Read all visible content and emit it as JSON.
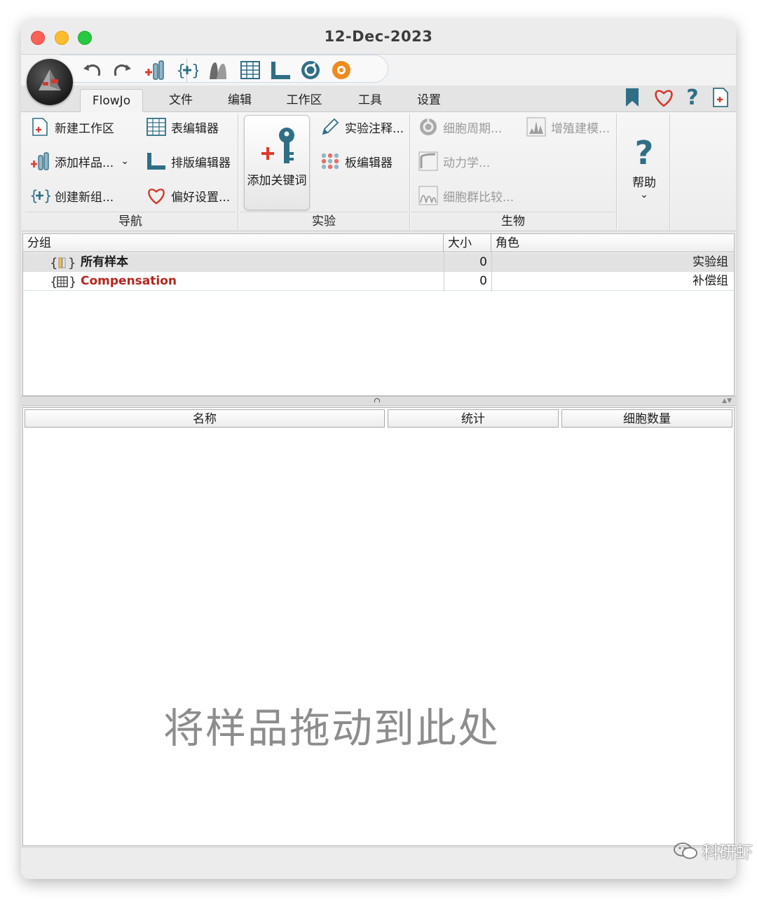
{
  "window": {
    "title": "12-Dec-2023"
  },
  "quick_toolbar": {
    "icons": [
      "undo-icon",
      "redo-icon",
      "add-samples-icon",
      "create-group-icon",
      "layer-icon",
      "table-icon",
      "layout-icon",
      "refresh-icon",
      "bio-icon"
    ]
  },
  "tabs": [
    "FlowJo",
    "文件",
    "编辑",
    "工作区",
    "工具",
    "设置"
  ],
  "ribbon": {
    "nav": {
      "new_workspace": "新建工作区",
      "add_samples": "添加样品...",
      "create_group": "创建新组...",
      "label": "导航"
    },
    "editors": {
      "table_editor": "表编辑器",
      "layout_editor": "排版编辑器",
      "preferences": "偏好设置..."
    },
    "experiment": {
      "add_keyword": "添加关键词",
      "annotate": "实验注释...",
      "plate_editor": "板编辑器",
      "label": "实验"
    },
    "biology": {
      "cell_cycle": "细胞周期...",
      "proliferation": "增殖建模...",
      "kinetics": "动力学...",
      "population_compare": "细胞群比较...",
      "label": "生物"
    },
    "help": {
      "label": "帮助"
    }
  },
  "group_table": {
    "headers": {
      "group": "分组",
      "size": "大小",
      "role": "角色"
    },
    "rows": [
      {
        "name": "所有样本",
        "size": "0",
        "role": "实验组",
        "color": "#1a1a1a"
      },
      {
        "name": "Compensation",
        "size": "0",
        "role": "补偿组",
        "color": "#b3261e"
      }
    ]
  },
  "sample_table": {
    "headers": {
      "name": "名称",
      "stats": "统计",
      "count": "细胞数量"
    },
    "empty_hint": "将样品拖动到此处"
  },
  "watermark": "科研虾"
}
